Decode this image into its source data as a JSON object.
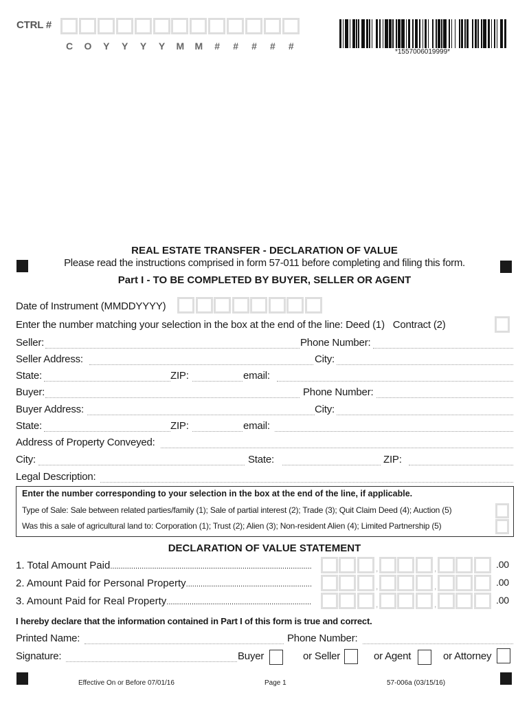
{
  "header": {
    "ctrl_label": "CTRL #",
    "ctrl_box_count": 13,
    "ctrl_format": [
      "C",
      "O",
      "Y",
      "Y",
      "Y",
      "Y",
      "M",
      "M",
      "#",
      "#",
      "#",
      "#",
      "#"
    ],
    "barcode_text": "*1557006019999*"
  },
  "titles": {
    "main": "REAL ESTATE TRANSFER - DECLARATION OF VALUE",
    "instructions": "Please read the instructions comprised in form 57-011 before completing and filing this form.",
    "part1": "Part I - TO BE COMPLETED BY BUYER, SELLER OR AGENT"
  },
  "part1": {
    "date_label": "Date of Instrument (MMDDYYYY)",
    "date_box_count": 8,
    "deed_contract_label": "Enter the number matching your selection in the box at the end of the line: Deed (1)   Contract (2)",
    "seller_label": "Seller:",
    "seller_phone_label": "Phone Number:",
    "seller_address_label": "Seller Address:",
    "seller_city_label": "City:",
    "seller_state_label": "State:",
    "seller_zip_label": "ZIP:",
    "seller_email_label": "email:",
    "buyer_label": "Buyer:",
    "buyer_phone_label": "Phone Number:",
    "buyer_address_label": "Buyer Address:",
    "buyer_city_label": "City:",
    "buyer_state_label": "State:",
    "buyer_zip_label": "ZIP:",
    "buyer_email_label": "email:",
    "property_address_label": "Address of Property Conveyed:",
    "property_city_label": "City:",
    "property_state_label": "State:",
    "property_zip_label": "ZIP:",
    "legal_description_label": "Legal Description:"
  },
  "selection_box": {
    "heading": "Enter the number corresponding to your selection in the box at the end of the line, if applicable.",
    "type_of_sale": "Type of Sale: Sale between related parties/family (1); Sale of partial interest (2); Trade (3); Quit Claim Deed (4); Auction (5)",
    "agricultural": "Was this a sale of agricultural land to: Corporation (1); Trust (2); Alien (3); Non-resident Alien (4); Limited Partnership (5)"
  },
  "value_statement": {
    "title": "DECLARATION OF VALUE STATEMENT",
    "rows": [
      {
        "label": "1. Total Amount Paid",
        "cents": ".00"
      },
      {
        "label": "2. Amount Paid for Personal Property",
        "cents": ".00"
      },
      {
        "label": "3. Amount Paid for Real Property",
        "cents": ".00"
      }
    ]
  },
  "declaration": {
    "statement": "I hereby declare that the information contained in Part I of this form is true and correct.",
    "printed_name_label": "Printed Name:",
    "phone_label": "Phone Number:",
    "signature_label": "Signature:",
    "roles": [
      {
        "label": "Buyer",
        "checked": false
      },
      {
        "label": "or Seller",
        "checked": false
      },
      {
        "label": "or Agent",
        "checked": false
      },
      {
        "label": "or Attorney",
        "checked": false
      }
    ]
  },
  "footer": {
    "effective": "Effective On or Before 07/01/16",
    "page": "Page 1",
    "form_id": "57-006a (03/15/16)"
  }
}
